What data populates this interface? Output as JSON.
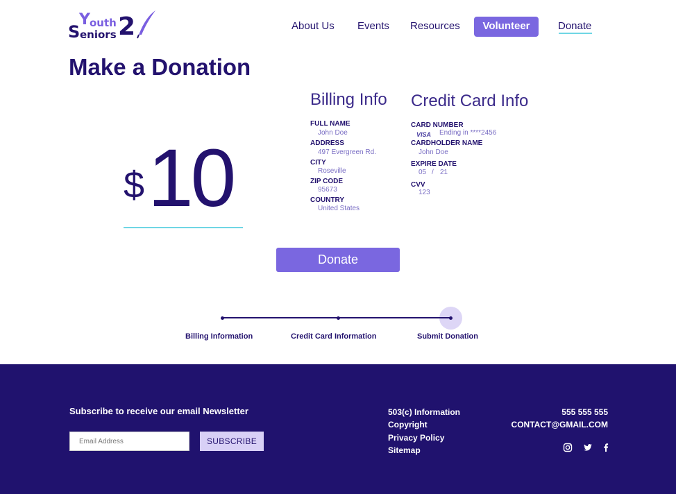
{
  "brand": {
    "y": "Y",
    "outh": "outh",
    "s": "S",
    "eniors": "eniors",
    "two": "2"
  },
  "nav": {
    "about": "About Us",
    "events": "Events",
    "resources": "Resources",
    "volunteer": "Volunteer",
    "donate": "Donate"
  },
  "page_title": "Make a Donation",
  "amount": {
    "currency": "$",
    "value": "10"
  },
  "billing": {
    "title": "Billing Info",
    "full_name_label": "FULL NAME",
    "full_name": "John Doe",
    "address_label": "ADDRESS",
    "address": "497 Evergreen Rd.",
    "city_label": "CITY",
    "city": "Roseville",
    "zip_label": "ZIP CODE",
    "zip": "95673",
    "country_label": "COUNTRY",
    "country": "United States"
  },
  "card": {
    "title": "Credit Card Info",
    "number_label": "CARD NUMBER",
    "brand": "VISA",
    "number": "Ending in ****2456",
    "holder_label": "CARDHOLDER NAME",
    "holder": "John Doe",
    "expiry_label": "EXPIRE DATE",
    "exp_month": "05",
    "exp_sep": "/",
    "exp_year": "21",
    "cvv_label": "CVV",
    "cvv": "123"
  },
  "donate_button": "Donate",
  "steps": {
    "step1": "Billing Information",
    "step2": "Credit Card Information",
    "step3": "Submit Donation"
  },
  "footer": {
    "newsletter_heading": "Subscribe to receive our email Newsletter",
    "email_placeholder": "Email Address",
    "subscribe": "SUBSCRIBE",
    "links": [
      "503(c) Information",
      "Copyright",
      "Privacy Policy",
      "Sitemap"
    ],
    "phone": "555 555 555",
    "email": "CONTACT@GMAIL.COM",
    "social_icons": [
      "instagram-icon",
      "twitter-icon",
      "facebook-icon"
    ]
  },
  "colors": {
    "navy": "#20126e",
    "accent": "#7a67e0",
    "underline": "#6fd6e4"
  }
}
